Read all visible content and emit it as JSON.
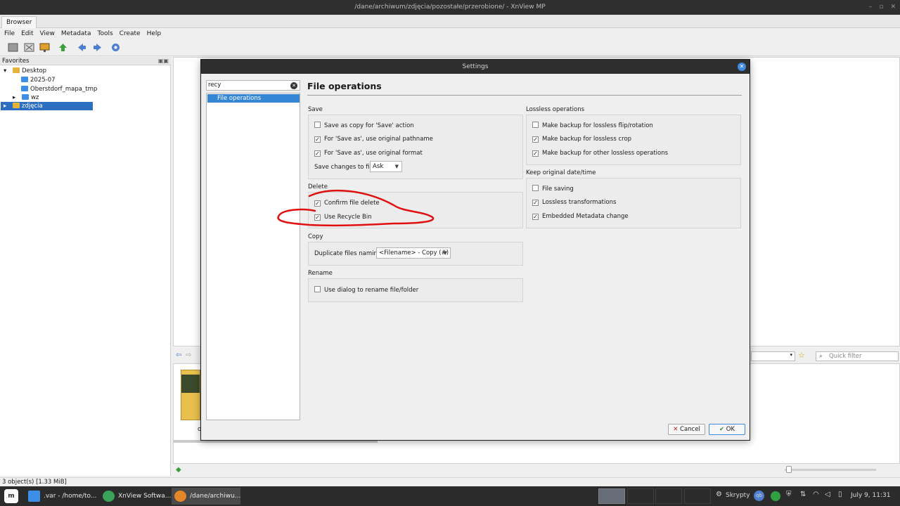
{
  "window": {
    "title": "/dane/archiwum/zdjęcia/pozostałe/przerobione/ - XnView MP",
    "controls": [
      "–",
      "▫",
      "✕"
    ]
  },
  "tabs": [
    "Browser"
  ],
  "menu": [
    "File",
    "Edit",
    "View",
    "Metadata",
    "Tools",
    "Create",
    "Help"
  ],
  "favorites": {
    "title": "Favorites",
    "items": [
      {
        "label": "Desktop",
        "toggle": "▾"
      },
      {
        "label": "2025-07"
      },
      {
        "label": "Oberstdorf_mapa_tmp"
      },
      {
        "label": "wz",
        "toggle": "▸"
      },
      {
        "label": "zdjęcia",
        "toggle": "▸"
      }
    ]
  },
  "browser": {
    "quick_filter_placeholder": "Quick filter",
    "thumb_caption": "o"
  },
  "status": {
    "text": "3 object(s) [1.33 MiB]"
  },
  "dialog": {
    "title": "Settings",
    "search_value": "recy",
    "categories": [
      "File operations"
    ],
    "heading": "File operations",
    "save": {
      "label": "Save",
      "options": [
        {
          "label": "Save as copy for 'Save' action",
          "checked": false
        },
        {
          "label": "For 'Save as', use original pathname",
          "checked": true
        },
        {
          "label": "For 'Save as', use original format",
          "checked": true
        }
      ],
      "changes_label": "Save changes to file",
      "changes_value": "Ask"
    },
    "delete": {
      "label": "Delete",
      "options": [
        {
          "label": "Confirm file delete",
          "checked": true
        },
        {
          "label": "Use Recycle Bin",
          "checked": true
        }
      ]
    },
    "copy": {
      "label": "Copy",
      "naming_label": "Duplicate files naming",
      "naming_value": "<Filename> - Copy (#)"
    },
    "rename": {
      "label": "Rename",
      "options": [
        {
          "label": "Use dialog to rename file/folder",
          "checked": false
        }
      ]
    },
    "lossless": {
      "label": "Lossless operations",
      "options": [
        {
          "label": "Make backup for lossless flip/rotation",
          "checked": false
        },
        {
          "label": "Make backup for lossless crop",
          "checked": true
        },
        {
          "label": "Make backup for other lossless operations",
          "checked": true
        }
      ]
    },
    "keepdate": {
      "label": "Keep original date/time",
      "options": [
        {
          "label": "File saving",
          "checked": false
        },
        {
          "label": "Lossless transformations",
          "checked": true
        },
        {
          "label": "Embedded Metadata change",
          "checked": true
        }
      ]
    },
    "buttons": {
      "cancel": "Cancel",
      "ok": "OK"
    },
    "annotation_color": "#e01010"
  },
  "taskbar": {
    "tasks": [
      {
        "label": ".var - /home/to..."
      },
      {
        "label": "XnView Softwa..."
      },
      {
        "label": "/dane/archiwu..."
      }
    ],
    "tray_label": "Skrypty",
    "clock": "July  9, 11:31"
  }
}
